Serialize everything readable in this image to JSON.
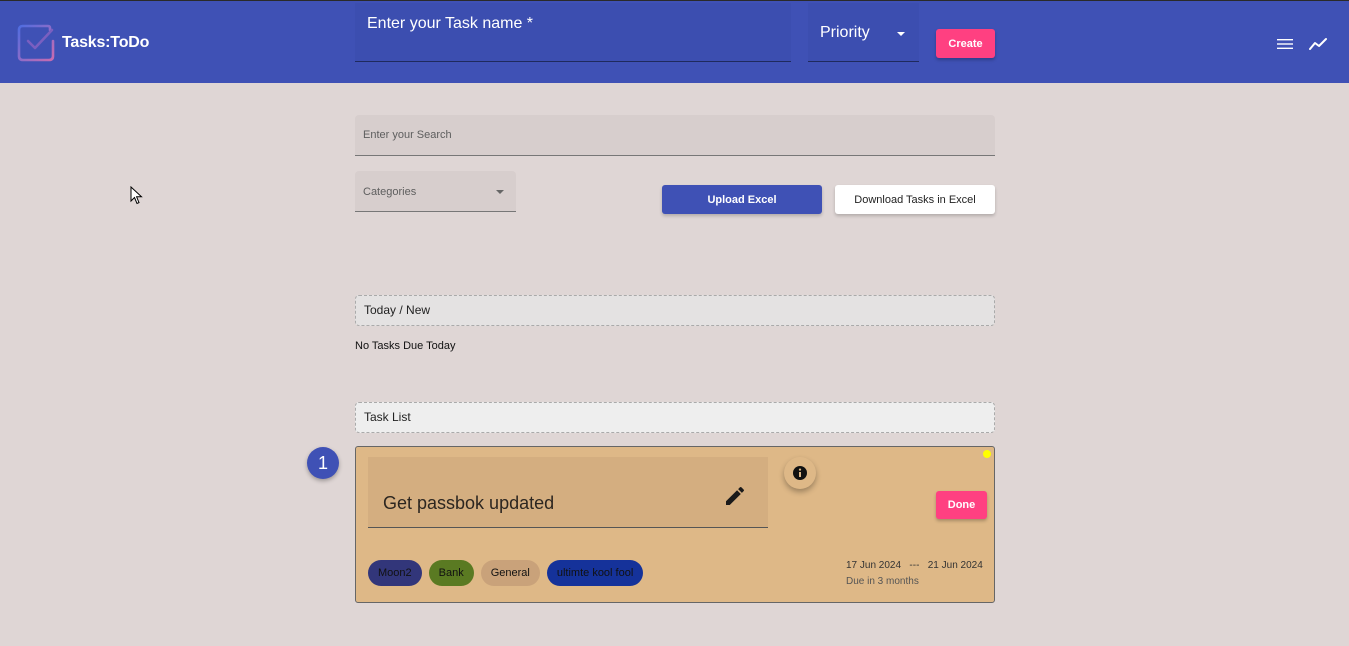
{
  "header": {
    "app_title": "Tasks:ToDo",
    "task_name_placeholder": "Enter your Task name *",
    "priority_label": "Priority",
    "create_label": "Create",
    "icons": [
      "menu-icon",
      "trending-up-icon"
    ]
  },
  "filters": {
    "search_placeholder": "Enter your Search",
    "categories_label": "Categories",
    "upload_label": "Upload Excel",
    "download_label": "Download Tasks in Excel"
  },
  "today_section": {
    "title": "Today / New",
    "empty_message": "No Tasks Due Today"
  },
  "task_list": {
    "title": "Task List",
    "tasks": [
      {
        "index": "1",
        "name": "Get passbok updated",
        "done_label": "Done",
        "status_color": "#ffff00",
        "card_color": "#deb887",
        "tags": [
          {
            "label": "Moon2",
            "color": "#32367a"
          },
          {
            "label": "Bank",
            "color": "#5a7a22"
          },
          {
            "label": "General",
            "color": "#c9a27a"
          },
          {
            "label": "ultimte kool fool",
            "color": "#15329a"
          }
        ],
        "start_date": "17 Jun 2024",
        "date_separator": "---",
        "end_date": "21 Jun 2024",
        "due_text": "Due in 3 months"
      }
    ]
  },
  "colors": {
    "primary": "#3f51b5",
    "accent": "#ff4081",
    "background": "#dfd6d5"
  }
}
